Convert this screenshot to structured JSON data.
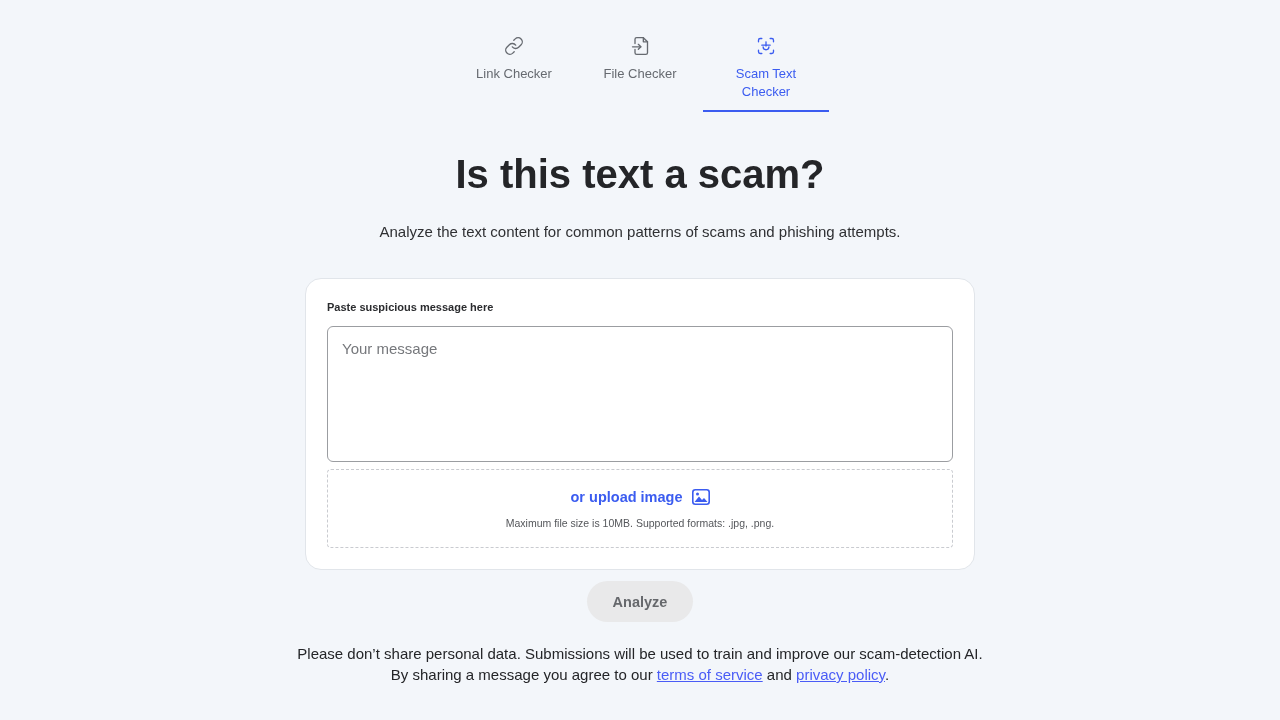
{
  "tabs": [
    {
      "label": "Link Checker",
      "selected": false
    },
    {
      "label": "File Checker",
      "selected": false
    },
    {
      "label": "Scam Text Checker",
      "selected": true
    }
  ],
  "heading": "Is this text a scam?",
  "subheading": "Analyze the text content for common patterns of scams and phishing attempts.",
  "form": {
    "label": "Paste suspicious message here",
    "message": {
      "placeholder": "Your message"
    },
    "upload": {
      "link": "or upload image",
      "note": "Maximum file size is 10MB. Supported formats: .jpg, .png."
    }
  },
  "analyze_button": {
    "label": "Analyze",
    "disabled": true
  },
  "disclaimer": {
    "notice": "Please don’t share personal data. Submissions will be used to train and improve our scam-detection AI.",
    "consent": {
      "before": "By sharing a message you agree to our",
      "terms_link": "terms of service",
      "between": "and",
      "privacy_link": "privacy policy",
      "after": "."
    }
  }
}
